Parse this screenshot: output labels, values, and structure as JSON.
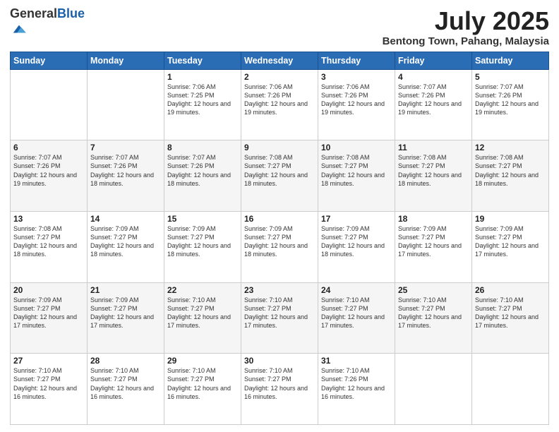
{
  "logo": {
    "general": "General",
    "blue": "Blue"
  },
  "header": {
    "month": "July 2025",
    "location": "Bentong Town, Pahang, Malaysia"
  },
  "weekdays": [
    "Sunday",
    "Monday",
    "Tuesday",
    "Wednesday",
    "Thursday",
    "Friday",
    "Saturday"
  ],
  "weeks": [
    [
      {
        "day": "",
        "info": ""
      },
      {
        "day": "",
        "info": ""
      },
      {
        "day": "1",
        "info": "Sunrise: 7:06 AM\nSunset: 7:25 PM\nDaylight: 12 hours and 19 minutes."
      },
      {
        "day": "2",
        "info": "Sunrise: 7:06 AM\nSunset: 7:26 PM\nDaylight: 12 hours and 19 minutes."
      },
      {
        "day": "3",
        "info": "Sunrise: 7:06 AM\nSunset: 7:26 PM\nDaylight: 12 hours and 19 minutes."
      },
      {
        "day": "4",
        "info": "Sunrise: 7:07 AM\nSunset: 7:26 PM\nDaylight: 12 hours and 19 minutes."
      },
      {
        "day": "5",
        "info": "Sunrise: 7:07 AM\nSunset: 7:26 PM\nDaylight: 12 hours and 19 minutes."
      }
    ],
    [
      {
        "day": "6",
        "info": "Sunrise: 7:07 AM\nSunset: 7:26 PM\nDaylight: 12 hours and 19 minutes."
      },
      {
        "day": "7",
        "info": "Sunrise: 7:07 AM\nSunset: 7:26 PM\nDaylight: 12 hours and 18 minutes."
      },
      {
        "day": "8",
        "info": "Sunrise: 7:07 AM\nSunset: 7:26 PM\nDaylight: 12 hours and 18 minutes."
      },
      {
        "day": "9",
        "info": "Sunrise: 7:08 AM\nSunset: 7:27 PM\nDaylight: 12 hours and 18 minutes."
      },
      {
        "day": "10",
        "info": "Sunrise: 7:08 AM\nSunset: 7:27 PM\nDaylight: 12 hours and 18 minutes."
      },
      {
        "day": "11",
        "info": "Sunrise: 7:08 AM\nSunset: 7:27 PM\nDaylight: 12 hours and 18 minutes."
      },
      {
        "day": "12",
        "info": "Sunrise: 7:08 AM\nSunset: 7:27 PM\nDaylight: 12 hours and 18 minutes."
      }
    ],
    [
      {
        "day": "13",
        "info": "Sunrise: 7:08 AM\nSunset: 7:27 PM\nDaylight: 12 hours and 18 minutes."
      },
      {
        "day": "14",
        "info": "Sunrise: 7:09 AM\nSunset: 7:27 PM\nDaylight: 12 hours and 18 minutes."
      },
      {
        "day": "15",
        "info": "Sunrise: 7:09 AM\nSunset: 7:27 PM\nDaylight: 12 hours and 18 minutes."
      },
      {
        "day": "16",
        "info": "Sunrise: 7:09 AM\nSunset: 7:27 PM\nDaylight: 12 hours and 18 minutes."
      },
      {
        "day": "17",
        "info": "Sunrise: 7:09 AM\nSunset: 7:27 PM\nDaylight: 12 hours and 18 minutes."
      },
      {
        "day": "18",
        "info": "Sunrise: 7:09 AM\nSunset: 7:27 PM\nDaylight: 12 hours and 17 minutes."
      },
      {
        "day": "19",
        "info": "Sunrise: 7:09 AM\nSunset: 7:27 PM\nDaylight: 12 hours and 17 minutes."
      }
    ],
    [
      {
        "day": "20",
        "info": "Sunrise: 7:09 AM\nSunset: 7:27 PM\nDaylight: 12 hours and 17 minutes."
      },
      {
        "day": "21",
        "info": "Sunrise: 7:09 AM\nSunset: 7:27 PM\nDaylight: 12 hours and 17 minutes."
      },
      {
        "day": "22",
        "info": "Sunrise: 7:10 AM\nSunset: 7:27 PM\nDaylight: 12 hours and 17 minutes."
      },
      {
        "day": "23",
        "info": "Sunrise: 7:10 AM\nSunset: 7:27 PM\nDaylight: 12 hours and 17 minutes."
      },
      {
        "day": "24",
        "info": "Sunrise: 7:10 AM\nSunset: 7:27 PM\nDaylight: 12 hours and 17 minutes."
      },
      {
        "day": "25",
        "info": "Sunrise: 7:10 AM\nSunset: 7:27 PM\nDaylight: 12 hours and 17 minutes."
      },
      {
        "day": "26",
        "info": "Sunrise: 7:10 AM\nSunset: 7:27 PM\nDaylight: 12 hours and 17 minutes."
      }
    ],
    [
      {
        "day": "27",
        "info": "Sunrise: 7:10 AM\nSunset: 7:27 PM\nDaylight: 12 hours and 16 minutes."
      },
      {
        "day": "28",
        "info": "Sunrise: 7:10 AM\nSunset: 7:27 PM\nDaylight: 12 hours and 16 minutes."
      },
      {
        "day": "29",
        "info": "Sunrise: 7:10 AM\nSunset: 7:27 PM\nDaylight: 12 hours and 16 minutes."
      },
      {
        "day": "30",
        "info": "Sunrise: 7:10 AM\nSunset: 7:27 PM\nDaylight: 12 hours and 16 minutes."
      },
      {
        "day": "31",
        "info": "Sunrise: 7:10 AM\nSunset: 7:26 PM\nDaylight: 12 hours and 16 minutes."
      },
      {
        "day": "",
        "info": ""
      },
      {
        "day": "",
        "info": ""
      }
    ]
  ]
}
